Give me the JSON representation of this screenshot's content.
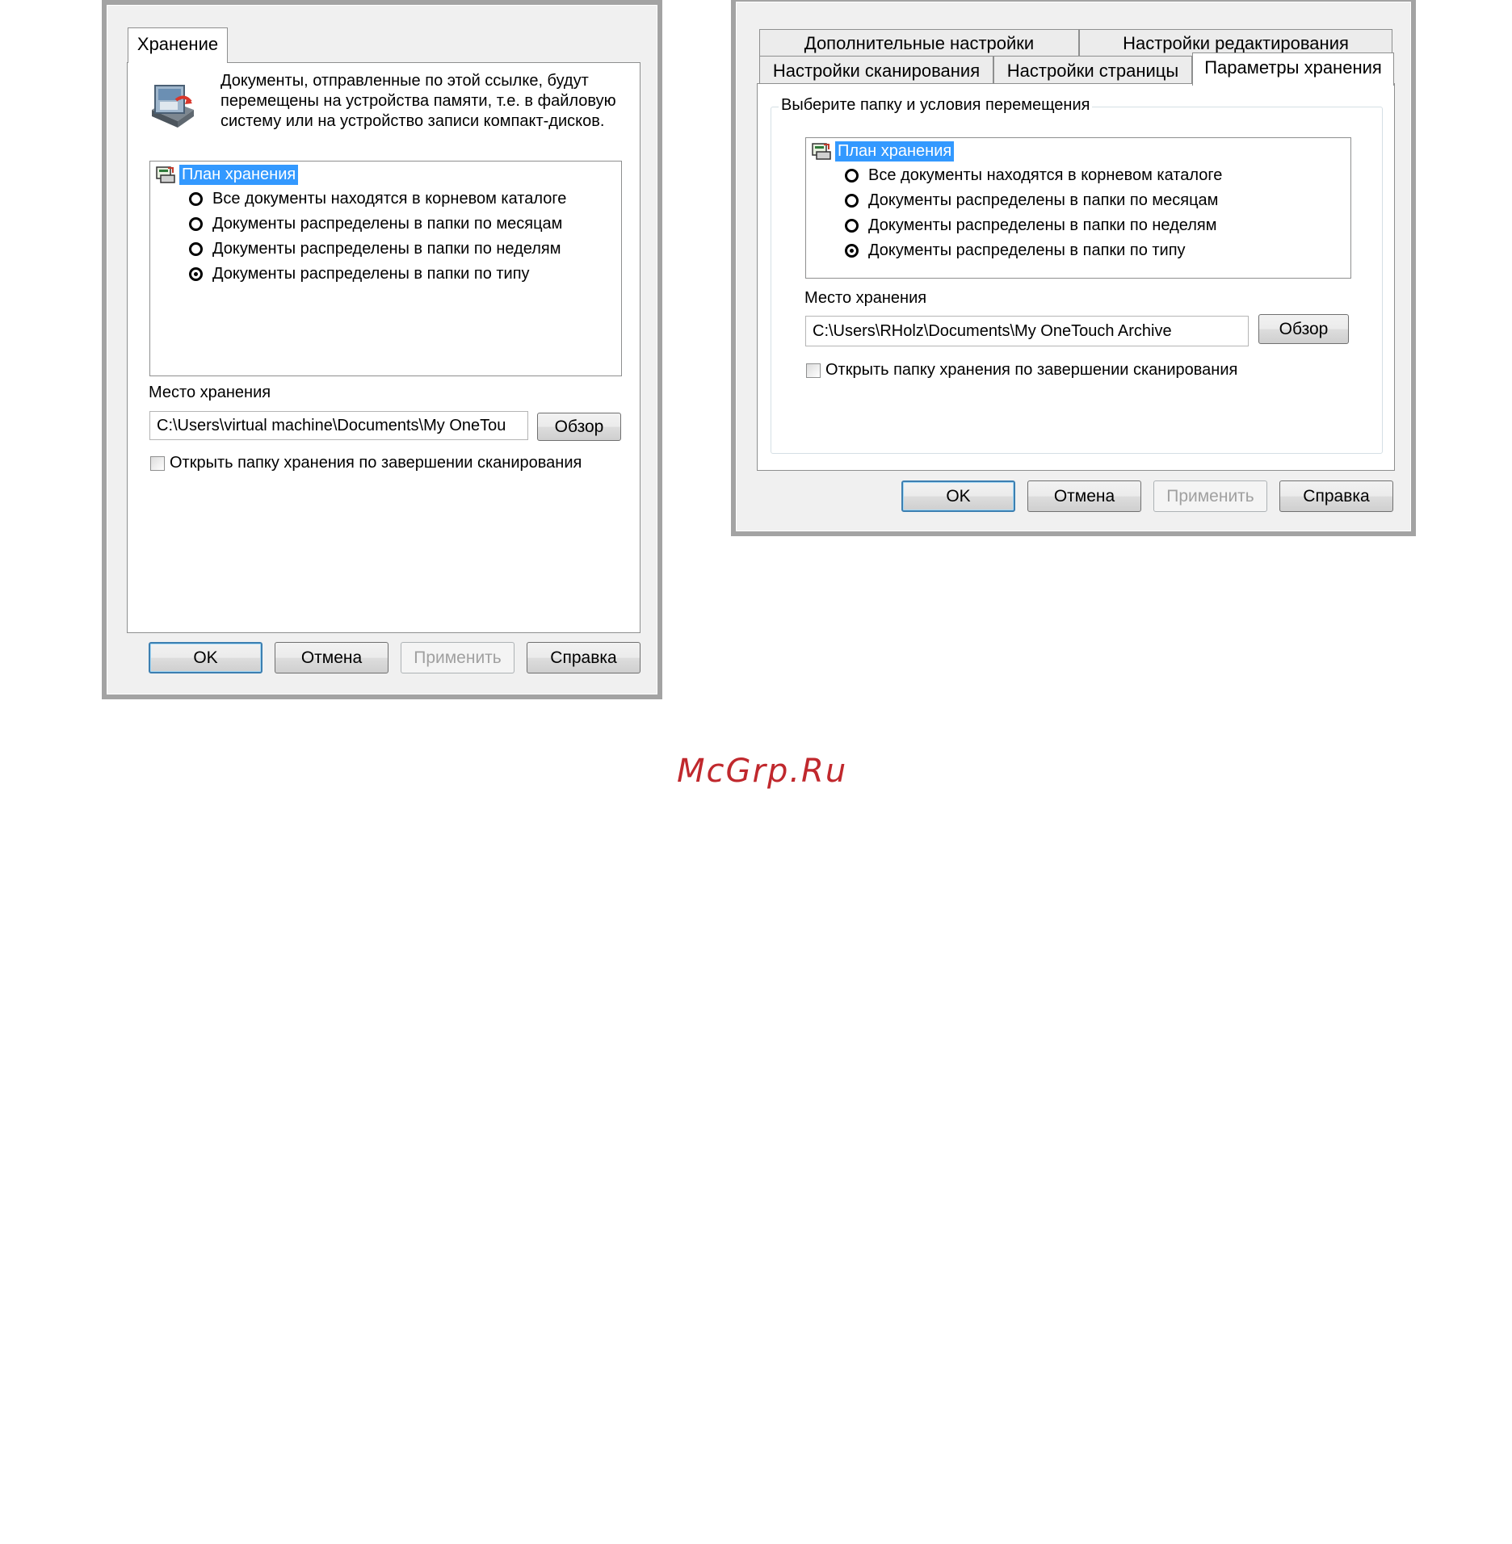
{
  "dialog1": {
    "tab": "Хранение",
    "description": "Документы, отправленные по этой ссылке, будут перемещены на устройства памяти, т.е. в файловую систему или на устройство записи компакт-дисков.",
    "tree_root": "План хранения",
    "options": [
      {
        "label": "Все документы находятся в корневом каталоге",
        "selected": false
      },
      {
        "label": "Документы распределены в папки по месяцам",
        "selected": false
      },
      {
        "label": "Документы распределены в папки по неделям",
        "selected": false
      },
      {
        "label": "Документы распределены в папки по типу",
        "selected": true
      }
    ],
    "location_label": "Место хранения",
    "location_value": "C:\\Users\\virtual machine\\Documents\\My OneTou",
    "browse_label": "Обзор",
    "checkbox_label": "Открыть папку хранения по завершении сканирования",
    "ok_label": "OK",
    "cancel_label": "Отмена",
    "apply_label": "Применить",
    "help_label": "Справка"
  },
  "dialog2": {
    "tabs_row1": [
      "Дополнительные настройки",
      "Настройки редактирования"
    ],
    "tabs_row2": [
      "Настройки сканирования",
      "Настройки страницы",
      "Параметры хранения"
    ],
    "group_label": "Выберите папку и условия перемещения",
    "tree_root": "План хранения",
    "options": [
      {
        "label": "Все документы находятся в корневом каталоге",
        "selected": false
      },
      {
        "label": "Документы распределены в папки по месяцам",
        "selected": false
      },
      {
        "label": "Документы распределены в папки по неделям",
        "selected": false
      },
      {
        "label": "Документы распределены в папки по типу",
        "selected": true
      }
    ],
    "location_label": "Место хранения",
    "location_value": "C:\\Users\\RHolz\\Documents\\My OneTouch Archive",
    "browse_label": "Обзор",
    "checkbox_label": "Открыть папку хранения по завершении сканирования",
    "ok_label": "OK",
    "cancel_label": "Отмена",
    "apply_label": "Применить",
    "help_label": "Справка"
  },
  "watermark": "McGrp.Ru",
  "colors": {
    "selection": "#3399ff",
    "watermark": "#c0282d",
    "dialog_bg": "#f0f0f0",
    "frame": "#a3a3a3"
  }
}
